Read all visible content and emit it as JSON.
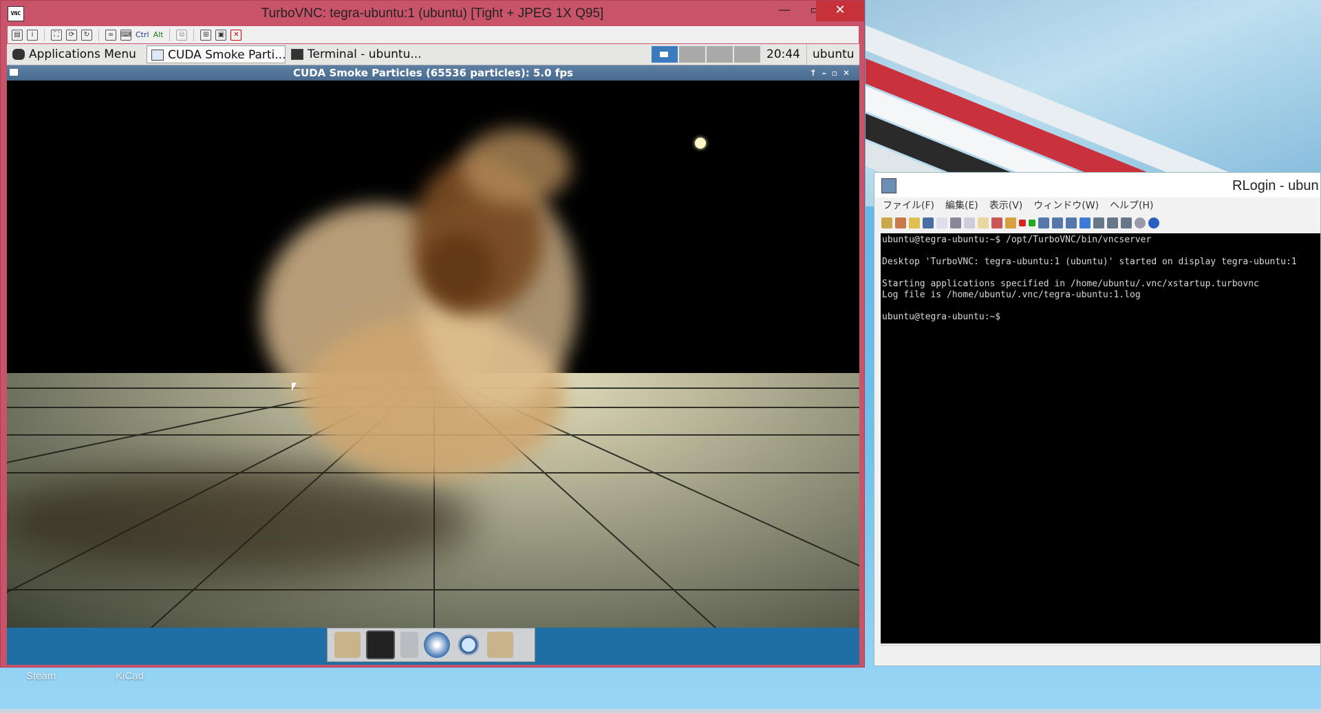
{
  "vnc": {
    "title": "TurboVNC: tegra-ubuntu:1 (ubuntu) [Tight + JPEG 1X Q95]",
    "icon_name": "vnc-icon",
    "toolbar_labels": {
      "ctrl": "Ctrl",
      "alt": "Alt"
    }
  },
  "panel": {
    "apps_menu": "Applications Menu",
    "task_cuda": "CUDA Smoke Parti...",
    "task_terminal": "Terminal - ubuntu...",
    "clock": "20:44",
    "user": "ubuntu"
  },
  "cuda_window": {
    "title": "CUDA Smoke Particles (65536 particles): 5.0 fps"
  },
  "rlogin": {
    "title": "RLogin - ubun",
    "menu": [
      "ファイル(F)",
      "編集(E)",
      "表示(V)",
      "ウィンドウ(W)",
      "ヘルプ(H)"
    ],
    "terminal_lines": [
      "ubuntu@tegra-ubuntu:~$ /opt/TurboVNC/bin/vncserver",
      "",
      "Desktop 'TurboVNC: tegra-ubuntu:1 (ubuntu)' started on display tegra-ubuntu:1",
      "",
      "Starting applications specified in /home/ubuntu/.vnc/xstartup.turbovnc",
      "Log file is /home/ubuntu/.vnc/tegra-ubuntu:1.log",
      "",
      "ubuntu@tegra-ubuntu:~$"
    ]
  },
  "desktop": {
    "icons": [
      "Steam",
      "KiCad"
    ]
  },
  "colors": {
    "vnc_frame": "#c9546a",
    "panel_bg": "#e6e6e4",
    "cuda_titlebar": "#5c7fa3",
    "dock_bg": "#1f6fa4",
    "terminal_bg": "#000000"
  }
}
